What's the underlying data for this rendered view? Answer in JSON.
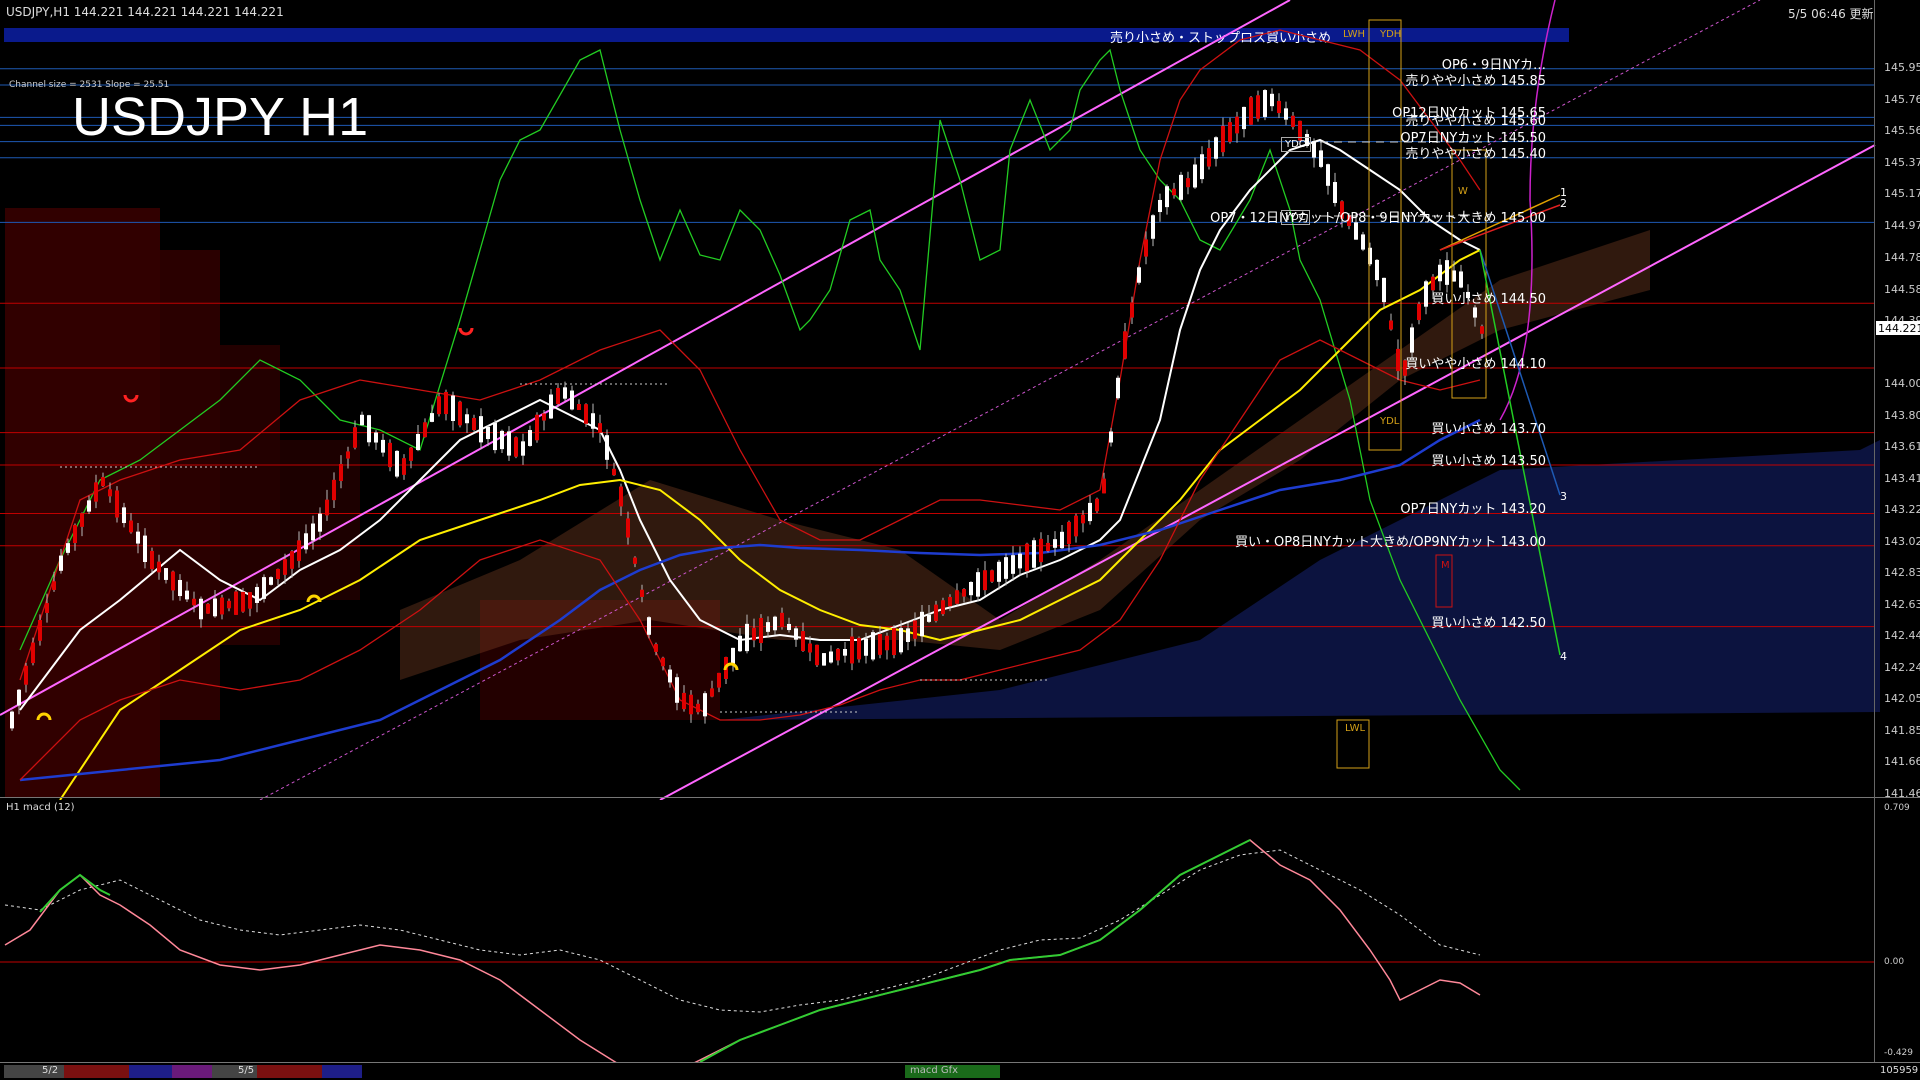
{
  "header": {
    "symbol_info": "USDJPY,H1  144.221 144.221 144.221 144.221",
    "datetime": "5/5 06:46 更新"
  },
  "title": "USDJPY H1",
  "channel_info": "Channel size = 2531 Slope = 25.51",
  "top_banner": "売り小さめ・ストップロス買い小さめ",
  "levels": [
    {
      "label": "OP6・9日NYカ…",
      "price": 145.95,
      "color": "#ffffff"
    },
    {
      "label": "売りやや小さめ 145.85",
      "price": 145.85,
      "color": "#ffffff"
    },
    {
      "label": "OP12日NYカット 145.65",
      "price": 145.65,
      "color": "#ffffff"
    },
    {
      "label": "売りやや小さめ 145.60",
      "price": 145.6,
      "color": "#ffffff"
    },
    {
      "label": "OP7日NYカット 145.50",
      "price": 145.5,
      "color": "#ffffff"
    },
    {
      "label": "売りやや小さめ 145.40",
      "price": 145.4,
      "color": "#ffffff"
    },
    {
      "label": "OP7・12日NYカット/OP8・9日NYカット大きめ 145.00",
      "price": 145.0,
      "color": "#ffffff"
    },
    {
      "label": "買い小さめ 144.50",
      "price": 144.5,
      "color": "#ffffff"
    },
    {
      "label": "買いやや小さめ 144.10",
      "price": 144.1,
      "color": "#ffffff"
    },
    {
      "label": "買い小さめ 143.70",
      "price": 143.7,
      "color": "#ffffff"
    },
    {
      "label": "買い小さめ 143.50",
      "price": 143.5,
      "color": "#ffffff"
    },
    {
      "label": "OP7日NYカット 143.20",
      "price": 143.2,
      "color": "#ffffff"
    },
    {
      "label": "買い・OP8日NYカット大きめ/OP9NYカット 143.00",
      "price": 143.0,
      "color": "#ffffff"
    },
    {
      "label": "買い小さめ 142.50",
      "price": 142.5,
      "color": "#ffffff"
    }
  ],
  "price_axis": [
    "145.955",
    "145.760",
    "145.565",
    "145.370",
    "145.175",
    "144.975",
    "144.780",
    "144.585",
    "144.390",
    "144.221",
    "144.000",
    "143.805",
    "143.610",
    "143.415",
    "143.220",
    "143.025",
    "142.830",
    "142.635",
    "142.440",
    "142.245",
    "142.050",
    "141.855",
    "141.660",
    "141.465"
  ],
  "current_price": "144.221",
  "boxes": {
    "ydh": "YDH",
    "ydo": "YDO",
    "ydc": "YDC",
    "ydl": "YDL",
    "lwl": "LWL",
    "lwh": "LWH",
    "m": "M",
    "w": "W"
  },
  "markers": [
    "1",
    "2",
    "3",
    "4"
  ],
  "macd": {
    "label": "H1  macd (12)",
    "axis_top": "0.709",
    "axis_zero": "0.00",
    "axis_bottom": "-0.429"
  },
  "footer": {
    "dates": [
      "5/2",
      "5/5"
    ],
    "tab": "macd Gfx",
    "count": "105959"
  },
  "colors": {
    "background": "#000000",
    "banner": "#0a1a8c",
    "red_line": "#c00000",
    "blue_line": "#1e5ab4",
    "magenta_channel": "#ff66ff",
    "macd_up": "#33cc33",
    "macd_down": "#ff8899"
  }
}
